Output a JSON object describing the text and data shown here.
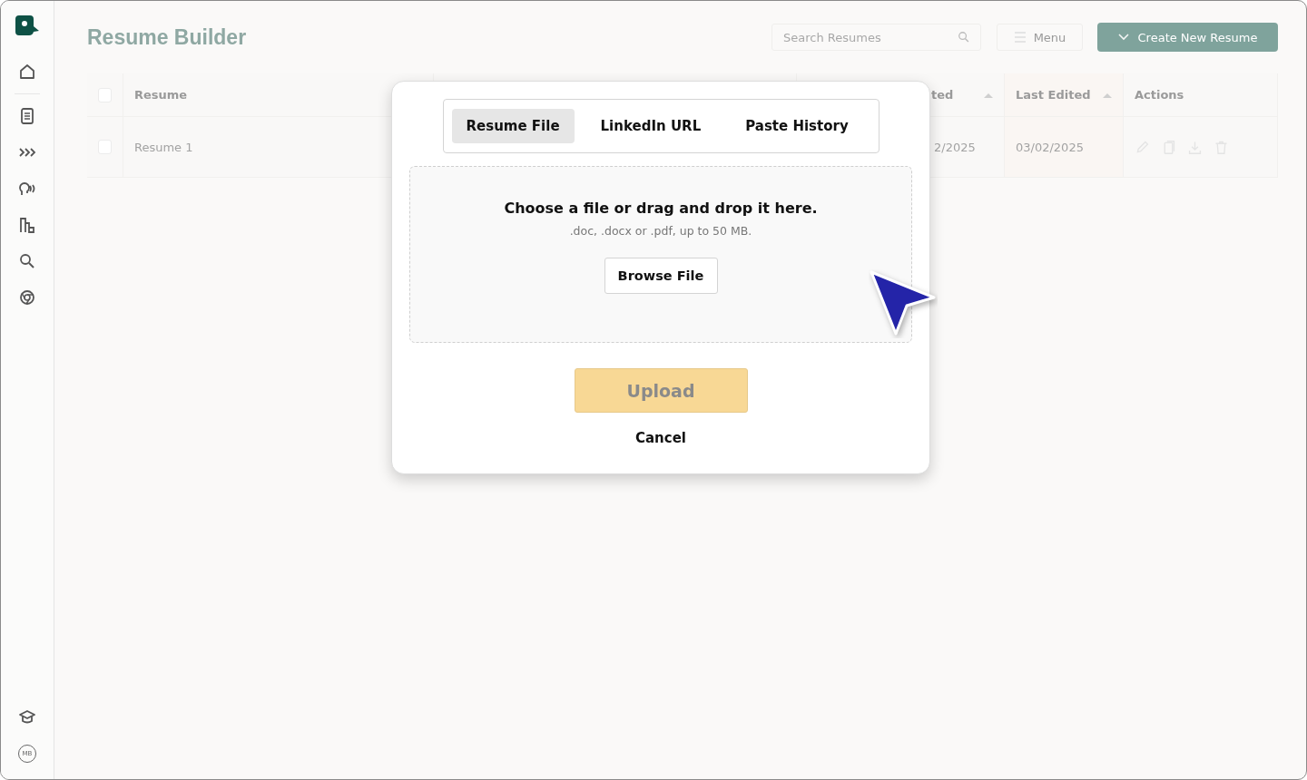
{
  "header": {
    "title": "Resume Builder",
    "search": {
      "placeholder": "Search Resumes"
    },
    "menu_button": "Menu",
    "create_button": "Create New Resume"
  },
  "sidebar": {
    "avatar_initials": "MB"
  },
  "table": {
    "all_checked": false,
    "columns": [
      {
        "label": "Resume"
      },
      {},
      {
        "label": "ted",
        "sort": true
      },
      {
        "label": "Last Edited",
        "sort": true
      },
      {
        "label": "Actions"
      }
    ],
    "rows": [
      {
        "cells": [
          "Resume 1",
          "",
          "2/2025",
          "03/02/2025"
        ],
        "checked": false
      }
    ]
  },
  "modal": {
    "tabs": [
      {
        "label": "Resume File",
        "selected": true
      },
      {
        "label": "LinkedIn URL",
        "selected": false
      },
      {
        "label": "Paste History",
        "selected": false
      }
    ],
    "drop_title": "Choose a file or drag and drop it here.",
    "drop_hint": ".doc, .docx or .pdf, up to 50 MB.",
    "browse_button": "Browse File",
    "upload_button": "Upload",
    "upload_disabled": true,
    "cancel": "Cancel"
  }
}
